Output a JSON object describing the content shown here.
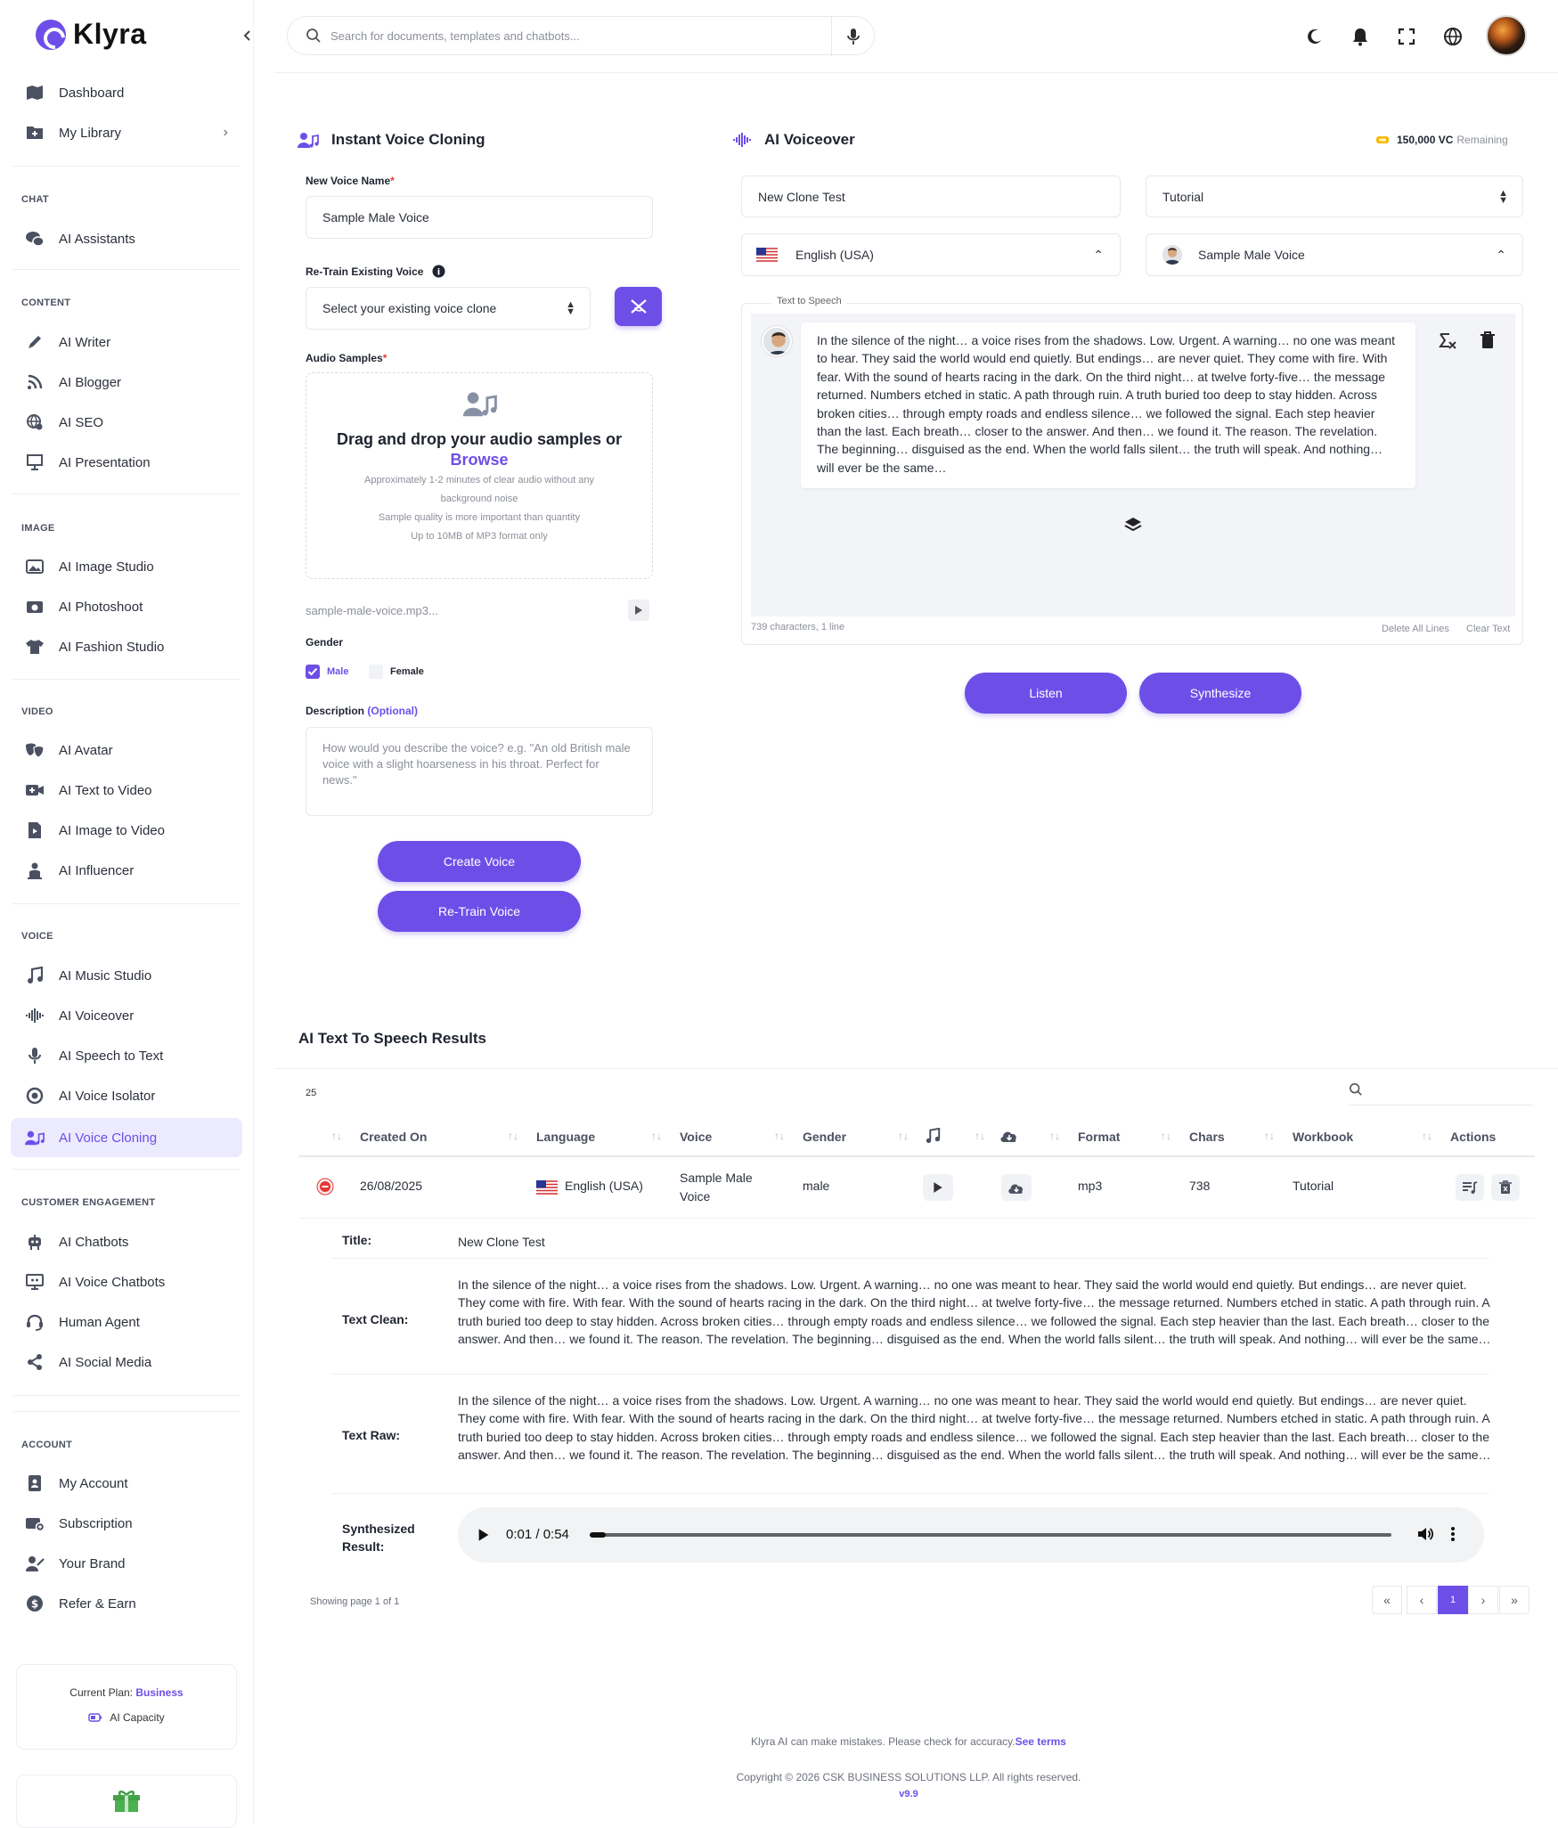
{
  "app": {
    "name": "Klyra"
  },
  "sidebar": {
    "top_items": [
      {
        "label": "Dashboard",
        "icon": "map-icon"
      },
      {
        "label": "My Library",
        "icon": "folder-plus-icon"
      }
    ],
    "sections": [
      {
        "title": "CHAT",
        "items": [
          {
            "label": "AI Assistants",
            "icon": "chat-icon"
          }
        ]
      },
      {
        "title": "CONTENT",
        "items": [
          {
            "label": "AI Writer",
            "icon": "pen-icon"
          },
          {
            "label": "AI Blogger",
            "icon": "blog-icon"
          },
          {
            "label": "AI SEO",
            "icon": "globe-gear-icon"
          },
          {
            "label": "AI Presentation",
            "icon": "presentation-icon"
          }
        ]
      },
      {
        "title": "IMAGE",
        "items": [
          {
            "label": "AI Image Studio",
            "icon": "image-icon"
          },
          {
            "label": "AI Photoshoot",
            "icon": "camera-icon"
          },
          {
            "label": "AI Fashion Studio",
            "icon": "shirt-icon"
          }
        ]
      },
      {
        "title": "VIDEO",
        "items": [
          {
            "label": "AI Avatar",
            "icon": "mask-icon"
          },
          {
            "label": "AI Text to Video",
            "icon": "video-plus-icon"
          },
          {
            "label": "AI Image to Video",
            "icon": "file-video-icon"
          },
          {
            "label": "AI Influencer",
            "icon": "influencer-icon"
          }
        ]
      },
      {
        "title": "VOICE",
        "items": [
          {
            "label": "AI Music Studio",
            "icon": "music-icon"
          },
          {
            "label": "AI Voiceover",
            "icon": "waveform-icon"
          },
          {
            "label": "AI Speech to Text",
            "icon": "microphone-icon"
          },
          {
            "label": "AI Voice Isolator",
            "icon": "target-icon"
          },
          {
            "label": "AI Voice Cloning",
            "icon": "user-music-icon"
          }
        ]
      },
      {
        "title": "CUSTOMER ENGAGEMENT",
        "items": [
          {
            "label": "AI Chatbots",
            "icon": "robot-icon"
          },
          {
            "label": "AI Voice Chatbots",
            "icon": "monitor-robot-icon"
          },
          {
            "label": "Human Agent",
            "icon": "headset-icon"
          },
          {
            "label": "AI Social Media",
            "icon": "share-icon"
          }
        ]
      },
      {
        "title": "ACCOUNT",
        "items": [
          {
            "label": "My Account",
            "icon": "id-card-icon"
          },
          {
            "label": "Subscription",
            "icon": "wallet-icon"
          },
          {
            "label": "Your Brand",
            "icon": "brand-icon"
          },
          {
            "label": "Refer & Earn",
            "icon": "dollar-circle-icon"
          }
        ]
      }
    ],
    "plan_label": "Current Plan:",
    "plan_name": "Business",
    "capacity_label": "AI Capacity"
  },
  "topbar": {
    "search_placeholder": "Search for documents, templates and chatbots..."
  },
  "cloning": {
    "title": "Instant Voice Cloning",
    "name_label": "New Voice Name",
    "name_value": "Sample Male Voice",
    "retrain_label": "Re-Train Existing Voice",
    "retrain_select": "Select your existing voice clone",
    "samples_label": "Audio Samples",
    "drop_title": "Drag and drop your audio samples or",
    "browse": "Browse",
    "note1": "Approximately 1-2 minutes of clear audio without any",
    "note2": "background noise",
    "note3": "Sample quality is more important than quantity",
    "note4": "Up to 10MB of MP3 format only",
    "file_name": "sample-male-voice.mp3...",
    "gender_label": "Gender",
    "gender_male": "Male",
    "gender_female": "Female",
    "desc_label": "Description",
    "desc_optional": "(Optional)",
    "desc_placeholder": "How would you describe the voice? e.g. \"An old British male voice with a slight hoarseness in his throat. Perfect for news.\"",
    "create_btn": "Create Voice",
    "retrain_btn": "Re-Train Voice"
  },
  "voiceover": {
    "title": "AI Voiceover",
    "credits_value": "150,000 VC",
    "credits_label": "Remaining",
    "title_input": "New Clone Test",
    "workbook_select": "Tutorial",
    "language_select": "English (USA)",
    "voice_select": "Sample Male Voice",
    "tts_label": "Text to Speech",
    "tts_text": "In the silence of the night… a voice rises from the shadows. Low. Urgent. A warning… no one was meant to hear. They said the world would end quietly. But endings… are never quiet. They come with fire. With fear. With the sound of hearts racing in the dark. On the third night… at twelve forty-five… the message returned. Numbers etched in static. A path through ruin. A truth buried too deep to stay hidden. Across broken cities… through empty roads and endless silence… we followed the signal. Each step heavier than the last. Each breath… closer to the answer. And then… we found it. The reason. The revelation. The beginning… disguised as the end. When the world falls silent… the truth will speak. And nothing… will ever be the same…",
    "char_count": "739 characters, 1 line",
    "delete_all": "Delete All Lines",
    "clear_text": "Clear Text",
    "listen_btn": "Listen",
    "synth_btn": "Synthesize"
  },
  "results": {
    "title": "AI Text To Speech Results",
    "page_size": "25",
    "columns": [
      "Created On",
      "Language",
      "Voice",
      "Gender",
      "Format",
      "Chars",
      "Workbook",
      "Actions"
    ],
    "row": {
      "created": "26/08/2025",
      "language": "English (USA)",
      "voice": "Sample Male Voice",
      "gender": "male",
      "format": "mp3",
      "chars": "738",
      "workbook": "Tutorial"
    },
    "detail": {
      "title_label": "Title:",
      "title_value": "New Clone Test",
      "clean_label": "Text Clean:",
      "raw_label": "Text Raw:",
      "text": "In the silence of the night… a voice rises from the shadows. Low. Urgent. A warning… no one was meant to hear. They said the world would end quietly. But endings… are never quiet. They come with fire. With fear. With the sound of hearts racing in the dark. On the third night… at twelve forty-five… the message returned. Numbers etched in static. A path through ruin. A truth buried too deep to stay hidden. Across broken cities… through empty roads and endless silence… we followed the signal. Each step heavier than the last. Each breath… closer to the answer. And then… we found it. The reason. The revelation. The beginning… disguised as the end. When the world falls silent… the truth will speak. And nothing… will ever be the same…",
      "synth_label_1": "Synthesized",
      "synth_label_2": "Result:",
      "time": "0:01 / 0:54",
      "progress": 0.02
    },
    "showing": "Showing page 1 of 1",
    "current_page": "1"
  },
  "footer": {
    "disclaimer": "Klyra AI can make mistakes. Please check for accuracy.",
    "see_terms": "See terms",
    "copyright": "Copyright © 2026 CSK BUSINESS SOLUTIONS LLP. All rights reserved.",
    "version": "v9.9"
  },
  "colors": {
    "accent": "#6d4fe8",
    "danger": "#e53935",
    "credit": "#f5b800"
  }
}
